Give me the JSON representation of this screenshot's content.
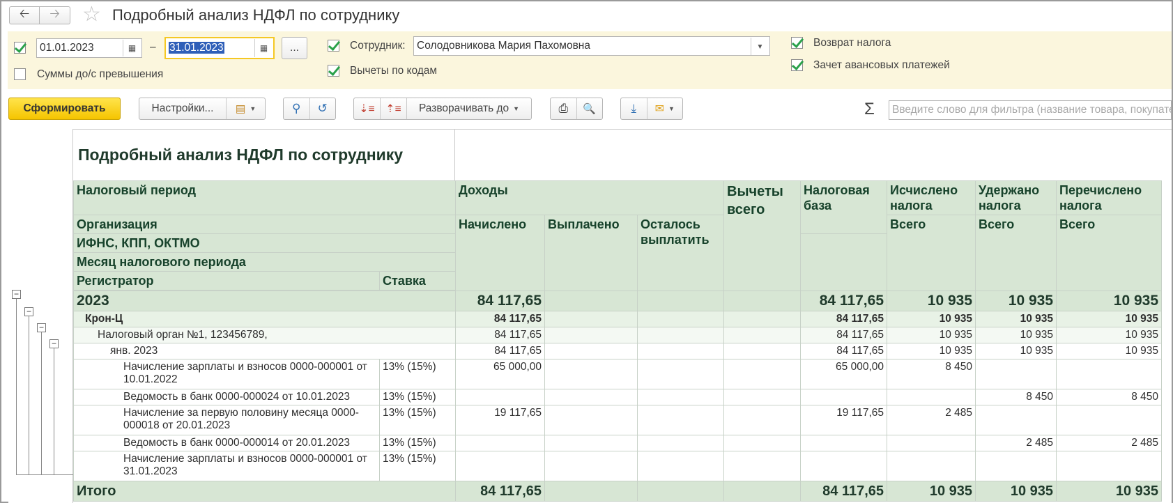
{
  "window": {
    "title": "Подробный анализ НДФЛ по сотруднику"
  },
  "filters": {
    "date_from": "01.01.2023",
    "date_to": "31.01.2023",
    "dash": "–",
    "period_button": "...",
    "amounts_over_label": "Суммы до/с превышения",
    "amounts_over_checked": false,
    "period_checked": true,
    "employee_label": "Сотрудник:",
    "employee_value": "Солодовникова Мария Пахомовна",
    "employee_checked": true,
    "deductions_label": "Вычеты по кодам",
    "deductions_checked": true,
    "refund_label": "Возврат налога",
    "refund_checked": true,
    "advance_label": "Зачет авансовых платежей",
    "advance_checked": true
  },
  "toolbar": {
    "generate_label": "Сформировать",
    "settings_label": "Настройки...",
    "expand_label": "Разворачивать до",
    "sigma": "Σ",
    "search_placeholder": "Введите слово для фильтра (название товара, покупателя...)"
  },
  "icons": {
    "back": "arrow-left-icon",
    "forward": "arrow-right-icon",
    "favorite": "star-icon",
    "calendar": "calendar-icon",
    "variants": "report-variants-icon",
    "search": "search-icon",
    "search_cancel": "search-cancel-icon",
    "sort_desc": "sort-desc-icon",
    "sort_asc": "sort-asc-icon",
    "print": "print-icon",
    "preview": "print-preview-icon",
    "save": "download-icon",
    "mail": "mail-icon",
    "collapse": "collapse-minus-icon"
  },
  "report": {
    "title": "Подробный анализ НДФЛ по сотруднику",
    "headers": {
      "tax_period": "Налоговый период",
      "income": "Доходы",
      "deductions_total": "Вычеты всего",
      "tax_base": "Налоговая база",
      "tax_calculated": "Исчислено налога",
      "tax_withheld": "Удержано налога",
      "tax_transferred": "Перечислено налога",
      "organization": "Организация",
      "ifns": "ИФНС, КПП, ОКТМО",
      "month": "Месяц налогового периода",
      "registrar": "Регистратор",
      "rate": "Ставка",
      "accrued": "Начислено",
      "paid": "Выплачено",
      "remaining": "Осталось выплатить",
      "total_calc": "Всего",
      "total_withheld": "Всего",
      "total_transferred": "Всего"
    },
    "rows": [
      {
        "type": "year",
        "name": "2023",
        "rate": "",
        "accrued": "84 117,65",
        "paid": "",
        "remaining": "",
        "deductions": "",
        "base": "84 117,65",
        "calc": "10 935",
        "withheld": "10 935",
        "transferred": "10 935"
      },
      {
        "type": "org",
        "name": "Крон-Ц",
        "rate": "",
        "accrued": "84 117,65",
        "paid": "",
        "remaining": "",
        "deductions": "",
        "base": "84 117,65",
        "calc": "10 935",
        "withheld": "10 935",
        "transferred": "10 935"
      },
      {
        "type": "tax",
        "name": "Налоговый орган №1, 123456789,",
        "rate": "",
        "accrued": "84 117,65",
        "paid": "",
        "remaining": "",
        "deductions": "",
        "base": "84 117,65",
        "calc": "10 935",
        "withheld": "10 935",
        "transferred": "10 935"
      },
      {
        "type": "month",
        "name": "янв. 2023",
        "rate": "",
        "accrued": "84 117,65",
        "paid": "",
        "remaining": "",
        "deductions": "",
        "base": "84 117,65",
        "calc": "10 935",
        "withheld": "10 935",
        "transferred": "10 935"
      },
      {
        "type": "doc",
        "name": "Начисление зарплаты и взносов 0000-000001 от 10.01.2022",
        "rate": "13% (15%)",
        "accrued": "65 000,00",
        "paid": "",
        "remaining": "",
        "deductions": "",
        "base": "65 000,00",
        "calc": "8 450",
        "withheld": "",
        "transferred": ""
      },
      {
        "type": "doc",
        "name": "Ведомость в банк 0000-000024 от 10.01.2023",
        "rate": "13% (15%)",
        "accrued": "",
        "paid": "",
        "remaining": "",
        "deductions": "",
        "base": "",
        "calc": "",
        "withheld": "8 450",
        "transferred": "8 450"
      },
      {
        "type": "doc",
        "name": "Начисление за первую половину месяца 0000-000018 от 20.01.2023",
        "rate": "13% (15%)",
        "accrued": "19 117,65",
        "paid": "",
        "remaining": "",
        "deductions": "",
        "base": "19 117,65",
        "calc": "2 485",
        "withheld": "",
        "transferred": ""
      },
      {
        "type": "doc",
        "name": "Ведомость в банк 0000-000014 от 20.01.2023",
        "rate": "13% (15%)",
        "accrued": "",
        "paid": "",
        "remaining": "",
        "deductions": "",
        "base": "",
        "calc": "",
        "withheld": "2 485",
        "transferred": "2 485"
      },
      {
        "type": "doc",
        "name": "Начисление зарплаты и взносов 0000-000001 от 31.01.2023",
        "rate": "13% (15%)",
        "accrued": "",
        "paid": "",
        "remaining": "",
        "deductions": "",
        "base": "",
        "calc": "",
        "withheld": "",
        "transferred": ""
      }
    ],
    "total": {
      "name": "Итого",
      "accrued": "84 117,65",
      "base": "84 117,65",
      "calc": "10 935",
      "withheld": "10 935",
      "transferred": "10 935"
    }
  }
}
